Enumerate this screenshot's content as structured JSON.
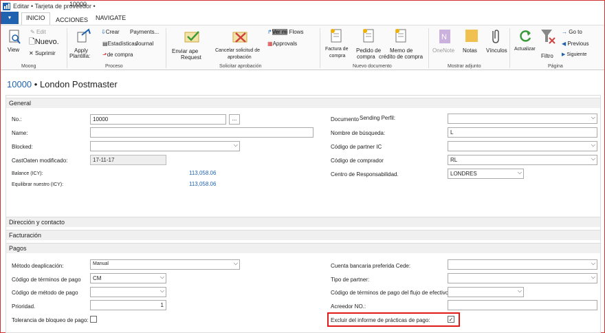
{
  "window": {
    "title": "Editar • Tarjeta de proveedor •",
    "title_overlay": "10000"
  },
  "tabs": {
    "file": "▾",
    "inicio": "INICIO",
    "acciones": "ACCIONES",
    "navigate": "NAVIGATE"
  },
  "ribbon": {
    "view": "View",
    "edit": "Edit",
    "nuevo": "Nuevo.",
    "suprimir": "Suprimir",
    "apply": "Apply",
    "plantilla": "Plantilla:",
    "crear": "Crear",
    "payments": "Payments...",
    "estadisticas": "Estadísticas",
    "journal": "Journal",
    "de_compra": "de compra",
    "enviar": "Enviar ape",
    "request": "Request",
    "cancelar": "Cancelar solicitud de",
    "aprobacion": "aprobación",
    "ver_mi": "Ver mi",
    "flows": "Flows",
    "approvals": "Approvals",
    "factura_l1": "Factura de",
    "factura_l2": "compra",
    "pedido_l1": "Pedido de",
    "pedido_l2": "compra",
    "memo_l1": "Memo de",
    "memo_l2": "crédito de compra",
    "onenote": "OneNote",
    "notas": "Notas",
    "vinculos": "Vínculos",
    "actualizar": "Actualizar",
    "filtro": "Filtro",
    "goto": "Go to",
    "previous": "Previous",
    "siguiente": "Siguiente",
    "groups": {
      "moong": "Moong",
      "proceso": "Proceso",
      "solicitar": "Solicitar aprobación",
      "nuevo_doc": "Nuevo documento",
      "mostrar": "Mostrar adjunto",
      "pagina": "Página"
    }
  },
  "header": {
    "no": "10000",
    "name": "• London Postmaster"
  },
  "sections": {
    "general": "General",
    "direccion": "Dirección y contacto",
    "facturacion": "Facturación",
    "pagos": "Pagos"
  },
  "general": {
    "no_label": "No.:",
    "no_value": "10000",
    "dots": "...",
    "name_label": "Name:",
    "name_value": "",
    "blocked_label": "Blocked:",
    "blocked_value": "",
    "modified_label": "CastOaten modificado:",
    "modified_value": "17-11-17",
    "balance_label": "Balance (ICY):",
    "balance_value": "113,058.06",
    "equilibrar_label": "Equilibrar nuestro (ICY):",
    "equilibrar_value": "113,058.06",
    "documento_label": "Documento",
    "sending_label": "Sending Perfil:",
    "sending_value": "",
    "busqueda_label": "Nombre de búsqueda:",
    "busqueda_value": "L",
    "partner_ic_label": "Código de partner IC",
    "partner_ic_value": "",
    "comprador_label": "Código de comprador",
    "comprador_value": "RL",
    "centro_label": "Centro de Responsabilidad.",
    "centro_value": "LONDRES"
  },
  "pagos": {
    "metodo_label": "Método deaplicación:",
    "metodo_value": "Manual",
    "terminos_label": "Código de términos de pago",
    "terminos_value": "CM",
    "metodo_pago_label": "Código de método de pago",
    "metodo_pago_value": "",
    "prioridad_label": "Prioridad.",
    "prioridad_value": "1",
    "tolerancia_label": "Tolerancia de bloqueo de pago:",
    "cuenta_label": "Cuenta bancaria preferida Cede:",
    "cuenta_value": "",
    "tipo_partner_label": "Tipo de partner:",
    "tipo_partner_value": "",
    "flujo_label": "Código de términos de pago del flujo de efectivo",
    "flujo_value": "",
    "acreedor_label": "Acreedor NO.:",
    "acreedor_value": "",
    "excluir_label": "Excluir del informe de prácticas de pago:",
    "excluir_checked": "✓"
  }
}
